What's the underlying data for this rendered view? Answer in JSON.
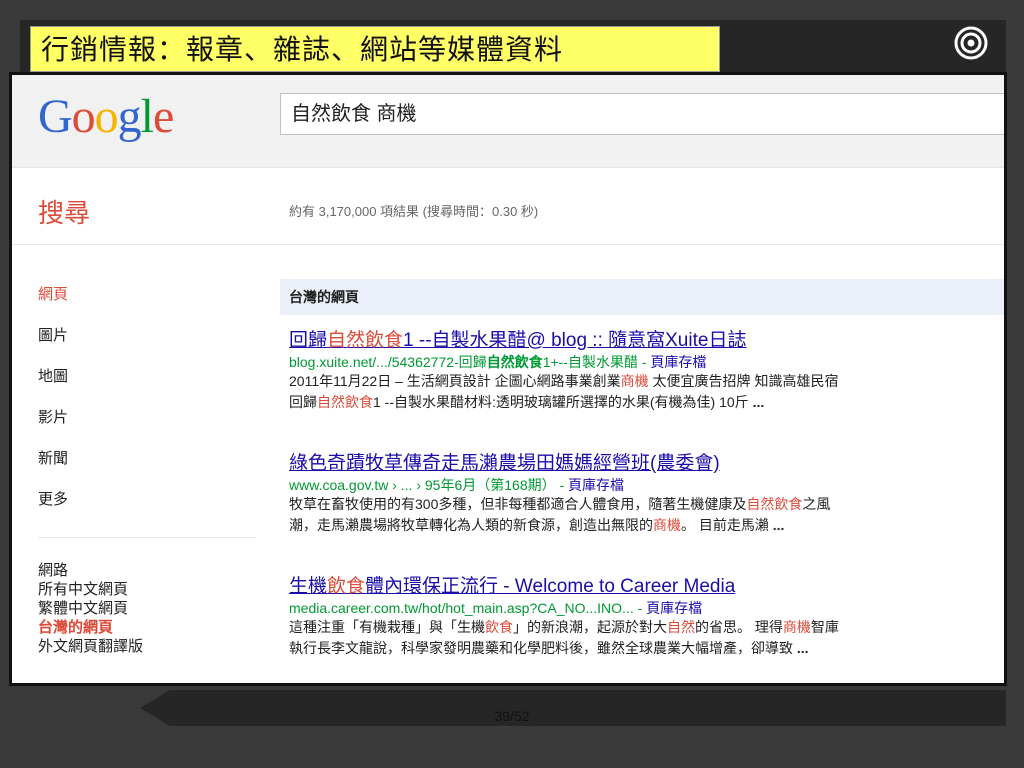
{
  "slide": {
    "title": "行銷情報：報章、雜誌、網站等媒體資料",
    "page": "39/52"
  },
  "google": {
    "logo_letters": [
      {
        "ch": "G",
        "color": "#3366cc"
      },
      {
        "ch": "o",
        "color": "#dd4b39"
      },
      {
        "ch": "o",
        "color": "#f5b400"
      },
      {
        "ch": "g",
        "color": "#3366cc"
      },
      {
        "ch": "l",
        "color": "#009933"
      },
      {
        "ch": "e",
        "color": "#dd4b39"
      }
    ],
    "query": "自然飲食 商機",
    "search_label": "搜尋",
    "stats": "約有 3,170,000 項結果 (搜尋時間：0.30 秒)",
    "nav": [
      "網頁",
      "圖片",
      "地圖",
      "影片",
      "新聞",
      "更多"
    ],
    "nav_active": 0,
    "nav2": [
      "網路",
      "所有中文網頁",
      "繁體中文網頁",
      "台灣的網頁",
      "外文網頁翻譯版"
    ],
    "nav2_active": 3,
    "section": "台灣的網頁",
    "results": [
      {
        "title": [
          {
            "t": "回歸",
            "hl": false
          },
          {
            "t": "自然飲食",
            "hl": true
          },
          {
            "t": "1 --自製水果醋@ blog :: 隨意窩Xuite日誌",
            "hl": false
          }
        ],
        "url": [
          {
            "t": "blog.xuite.net/.../54362772-回歸",
            "s": ""
          },
          {
            "t": "自然飲食",
            "s": "b"
          },
          {
            "t": "1+--自製水果醋 - ",
            "s": ""
          },
          {
            "t": "頁庫存檔",
            "s": "cache"
          }
        ],
        "snippet": [
          [
            {
              "t": "2011年11月22日 – 生活網頁設計 企圖心網路事業創業",
              "s": ""
            },
            {
              "t": "商機",
              "s": "hl"
            },
            {
              "t": " 太便宜廣告招牌 知識高雄民宿",
              "s": ""
            }
          ],
          [
            {
              "t": "回歸",
              "s": ""
            },
            {
              "t": "自然飲食",
              "s": "hl"
            },
            {
              "t": "1 --自製水果醋材料:透明玻璃罐所選擇的水果(有機為佳) 10斤 ",
              "s": ""
            },
            {
              "t": "...",
              "s": "b"
            }
          ]
        ]
      },
      {
        "title": [
          {
            "t": "綠色奇蹟牧草傳奇走馬瀨農場田媽媽經營班(農委會)",
            "hl": false
          }
        ],
        "url": [
          {
            "t": "www.coa.gov.tw › ... › 95年6月（第168期） - ",
            "s": ""
          },
          {
            "t": "頁庫存檔",
            "s": "cache"
          }
        ],
        "snippet": [
          [
            {
              "t": "牧草在畜牧使用的有300多種，但非每種都適合人體食用，隨著生機健康及",
              "s": ""
            },
            {
              "t": "自然飲食",
              "s": "hl"
            },
            {
              "t": "之風",
              "s": ""
            }
          ],
          [
            {
              "t": "潮，走馬瀨農場將牧草轉化為人類的新食源，創造出無限的",
              "s": ""
            },
            {
              "t": "商機",
              "s": "hl"
            },
            {
              "t": "。 目前走馬瀨 ",
              "s": ""
            },
            {
              "t": "...",
              "s": "b"
            }
          ]
        ]
      },
      {
        "title": [
          {
            "t": "生機",
            "hl": false
          },
          {
            "t": "飲食",
            "hl": true
          },
          {
            "t": "體內環保正流行 - Welcome to Career Media",
            "hl": false
          }
        ],
        "url": [
          {
            "t": "media.career.com.tw/hot/hot_main.asp?CA_NO...INO... - ",
            "s": ""
          },
          {
            "t": "頁庫存檔",
            "s": "cache"
          }
        ],
        "snippet": [
          [
            {
              "t": "這種注重「有機栽種」與「生機",
              "s": ""
            },
            {
              "t": "飲食",
              "s": "hl"
            },
            {
              "t": "」的新浪潮，起源於對大",
              "s": ""
            },
            {
              "t": "自然",
              "s": "hl"
            },
            {
              "t": "的省思。 理得",
              "s": ""
            },
            {
              "t": "商機",
              "s": "hl"
            },
            {
              "t": "智庫",
              "s": ""
            }
          ],
          [
            {
              "t": "執行長李文龍說，科學家發明農藥和化學肥料後，雖然全球農業大幅增產，卻導致 ",
              "s": ""
            },
            {
              "t": "...",
              "s": "b"
            }
          ]
        ]
      }
    ]
  }
}
